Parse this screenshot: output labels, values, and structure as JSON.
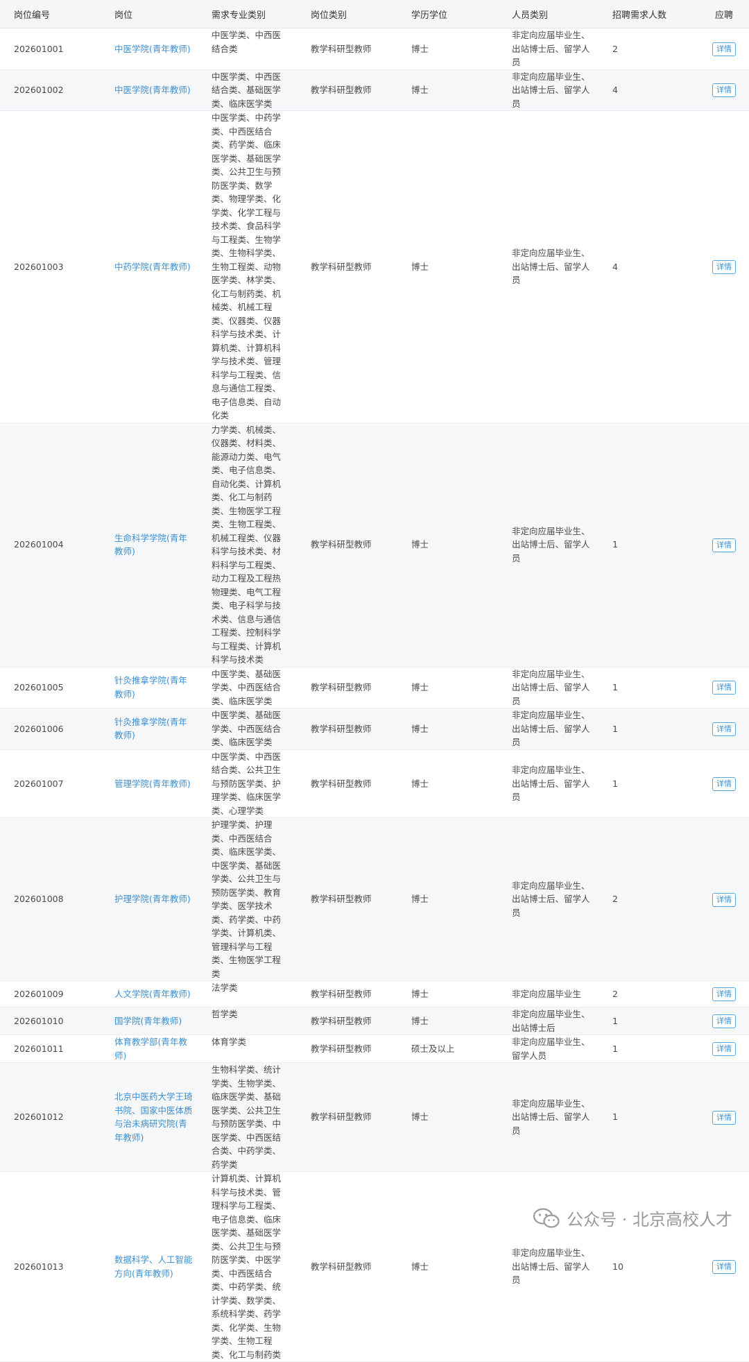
{
  "table": {
    "headers": [
      "岗位编号",
      "岗位",
      "需求专业类别",
      "岗位类别",
      "学历学位",
      "人员类别",
      "招聘需求人数",
      "应聘"
    ],
    "rows": [
      {
        "id": "202601001",
        "position": "中医学院(青年教师)",
        "majors": "中医学类、中西医结合类",
        "category": "教学科研型教师",
        "degree": "博士",
        "personnel": "非定向应届毕业生、出站博士后、留学人员",
        "count": "2",
        "action": "详情"
      },
      {
        "id": "202601002",
        "position": "中医学院(青年教师)",
        "majors": "中医学类、中西医结合类、基础医学类、临床医学类",
        "category": "教学科研型教师",
        "degree": "博士",
        "personnel": "非定向应届毕业生、出站博士后、留学人员",
        "count": "4",
        "action": "详情"
      },
      {
        "id": "202601003",
        "position": "中药学院(青年教师)",
        "majors": "中医学类、中药学类、中西医结合类、药学类、临床医学类、基础医学类、公共卫生与预防医学类、数学类、物理学类、化学类、化学工程与技术类、食品科学与工程类、生物学类、生物科学类、生物工程类、动物医学类、林学类、化工与制药类、机械类、机械工程类、仪器类、仪器科学与技术类、计算机类、计算机科学与技术类、管理科学与工程类、信息与通信工程类、电子信息类、自动化类",
        "category": "教学科研型教师",
        "degree": "博士",
        "personnel": "非定向应届毕业生、出站博士后、留学人员",
        "count": "4",
        "action": "详情"
      },
      {
        "id": "202601004",
        "position": "生命科学学院(青年教师)",
        "majors": "力学类、机械类、仪器类、材料类、能源动力类、电气类、电子信息类、自动化类、计算机类、化工与制药类、生物医学工程类、生物工程类、机械工程类、仪器科学与技术类、材料科学与工程类、动力工程及工程热物理类、电气工程类、电子科学与技术类、信息与通信工程类、控制科学与工程类、计算机科学与技术类",
        "category": "教学科研型教师",
        "degree": "博士",
        "personnel": "非定向应届毕业生、出站博士后、留学人员",
        "count": "1",
        "action": "详情"
      },
      {
        "id": "202601005",
        "position": "针灸推拿学院(青年教师)",
        "majors": "中医学类、基础医学类、中西医结合类、临床医学类",
        "category": "教学科研型教师",
        "degree": "博士",
        "personnel": "非定向应届毕业生、出站博士后、留学人员",
        "count": "1",
        "action": "详情"
      },
      {
        "id": "202601006",
        "position": "针灸推拿学院(青年教师)",
        "majors": "中医学类、基础医学类、中西医结合类、临床医学类",
        "category": "教学科研型教师",
        "degree": "博士",
        "personnel": "非定向应届毕业生、出站博士后、留学人员",
        "count": "1",
        "action": "详情"
      },
      {
        "id": "202601007",
        "position": "管理学院(青年教师)",
        "majors": "中医学类、中西医结合类、公共卫生与预防医学类、护理学类、临床医学类、心理学类",
        "category": "教学科研型教师",
        "degree": "博士",
        "personnel": "非定向应届毕业生、出站博士后、留学人员",
        "count": "1",
        "action": "详情"
      },
      {
        "id": "202601008",
        "position": "护理学院(青年教师)",
        "majors": "护理学类、护理类、中西医结合类、临床医学类、中医学类、基础医学类、公共卫生与预防医学类、教育学类、医学技术类、药学类、中药学类、计算机类、管理科学与工程类、生物医学工程类",
        "category": "教学科研型教师",
        "degree": "博士",
        "personnel": "非定向应届毕业生、出站博士后、留学人员",
        "count": "2",
        "action": "详情"
      },
      {
        "id": "202601009",
        "position": "人文学院(青年教师)",
        "majors": "法学类",
        "category": "教学科研型教师",
        "degree": "博士",
        "personnel": "非定向应届毕业生",
        "count": "2",
        "action": "详情"
      },
      {
        "id": "202601010",
        "position": "国学院(青年教师)",
        "majors": "哲学类",
        "category": "教学科研型教师",
        "degree": "博士",
        "personnel": "非定向应届毕业生、出站博士后",
        "count": "1",
        "action": "详情"
      },
      {
        "id": "202601011",
        "position": "体育教学部(青年教师)",
        "majors": "体育学类",
        "category": "教学科研型教师",
        "degree": "硕士及以上",
        "personnel": "非定向应届毕业生、留学人员",
        "count": "1",
        "action": "详情"
      },
      {
        "id": "202601012",
        "position": "北京中医药大学王琦书院、国家中医体质与治未病研究院(青年教师)",
        "majors": "生物科学类、统计学类、生物学类、临床医学类、基础医学类、公共卫生与预防医学类、中医学类、中西医结合类、中药学类、药学类",
        "category": "教学科研型教师",
        "degree": "博士",
        "personnel": "非定向应届毕业生、出站博士后、留学人员",
        "count": "1",
        "action": "详情"
      },
      {
        "id": "202601013",
        "position": "数据科学、人工智能方向(青年教师)",
        "majors": "计算机类、计算机科学与技术类、管理科学与工程类、电子信息类、临床医学类、基础医学类、公共卫生与预防医学类、中医学类、中西医结合类、中药学类、统计学类、数学类、系统科学类、药学类、化学类、生物学类、生物工程类、化工与制药类",
        "category": "教学科研型教师",
        "degree": "博士",
        "personnel": "非定向应届毕业生、出站博士后、留学人员",
        "count": "10",
        "action": "详情"
      }
    ]
  },
  "watermark": {
    "text": "公众号 · 北京高校人才",
    "icon": "wechat-icon"
  },
  "colors": {
    "link": "#3d8fcf",
    "header_bg": "#f5f6f8",
    "alt_row_bg": "#f6f7f9"
  }
}
